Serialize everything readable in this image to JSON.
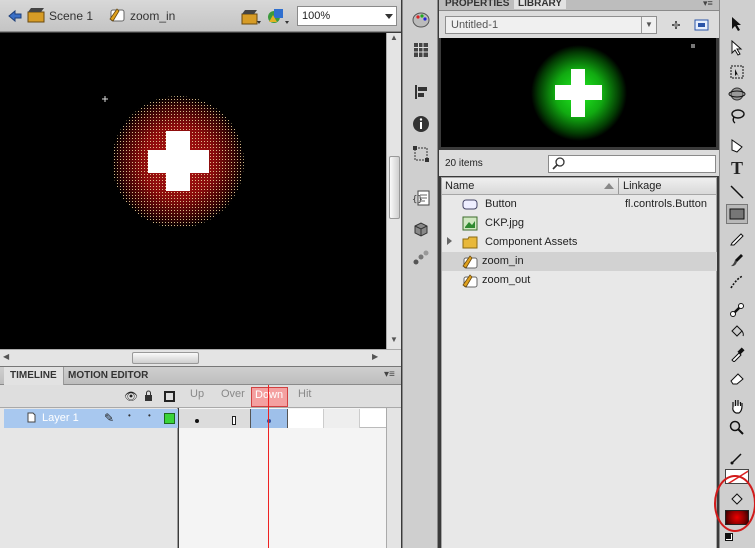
{
  "stage_bar": {
    "scene_label": "Scene 1",
    "symbol_label": "zoom_in",
    "zoom_value": "100%"
  },
  "timeline": {
    "tabs": [
      "TIMELINE",
      "MOTION EDITOR"
    ],
    "frame_labels": [
      "Up",
      "Over",
      "Down",
      "Hit"
    ],
    "layer_name": "Layer 1"
  },
  "library": {
    "tabs": [
      "PROPERTIES",
      "LIBRARY"
    ],
    "document": "Untitled-1",
    "item_count": "20 items",
    "columns": {
      "name": "Name",
      "linkage": "Linkage"
    },
    "items": [
      {
        "name": "Button",
        "linkage": "fl.controls.Button",
        "icon": "button-symbol-icon"
      },
      {
        "name": "CKP.jpg",
        "linkage": "",
        "icon": "bitmap-icon"
      },
      {
        "name": "Component Assets",
        "linkage": "",
        "icon": "folder-icon"
      },
      {
        "name": "zoom_in",
        "linkage": "",
        "icon": "button-symbol-icon"
      },
      {
        "name": "zoom_out",
        "linkage": "",
        "icon": "button-symbol-icon"
      }
    ]
  },
  "colors": {
    "selection_blue": "#a8c8ef",
    "stage_bg": "#000000",
    "zoom_in_fill": "#b21414",
    "preview_glow": "#22ee22",
    "highlight_circle": "#d11b1b"
  }
}
